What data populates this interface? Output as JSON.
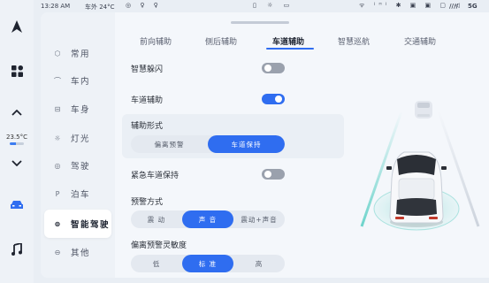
{
  "status_bar": {
    "time": "13:28 AM",
    "outside_temp": "车外 24°C",
    "left_icons": "◎ ♀ ♀",
    "center_icons": "▯ ☼ ▭",
    "right_icons": "ᯤ ⁽ᴴ⁾ ✱ ▣ ▣ ▢ ◁",
    "signal": "////",
    "network": "5G"
  },
  "dock": {
    "temperature": "23.5°C"
  },
  "sidebar": {
    "items": [
      {
        "label": "常用",
        "icon": "⬡"
      },
      {
        "label": "车内",
        "icon": "⌒"
      },
      {
        "label": "车身",
        "icon": "⊟"
      },
      {
        "label": "灯光",
        "icon": "☼"
      },
      {
        "label": "驾驶",
        "icon": "◎"
      },
      {
        "label": "泊车",
        "icon": "P"
      },
      {
        "label": "智能驾驶",
        "icon": "⊜"
      },
      {
        "label": "其他",
        "icon": "⊖"
      }
    ],
    "active_index": 6
  },
  "tabs": [
    "前向辅助",
    "侧后辅助",
    "车道辅助",
    "智慧巡航",
    "交通辅助"
  ],
  "active_tab": "车道辅助",
  "settings": {
    "smart_evasion": {
      "label": "智慧躲闪",
      "on": false
    },
    "lane_assist": {
      "label": "车道辅助",
      "on": true
    },
    "assist_form": {
      "label": "辅助形式",
      "options": [
        "偏离预警",
        "车道保持"
      ],
      "selected": "车道保持"
    },
    "emergency_lane_keep": {
      "label": "紧急车道保持",
      "on": false
    },
    "warning_mode": {
      "label": "预警方式",
      "options": [
        "震 动",
        "声 音",
        "震动+声音"
      ],
      "selected": "声 音"
    },
    "departure_sensitivity": {
      "label": "偏离预警灵敏度",
      "options": [
        "低",
        "标 准",
        "高"
      ],
      "selected": "标 准"
    }
  },
  "colors": {
    "accent": "#2f6df0",
    "toggle_off": "#9aa1ad",
    "background": "#e9eef4"
  }
}
